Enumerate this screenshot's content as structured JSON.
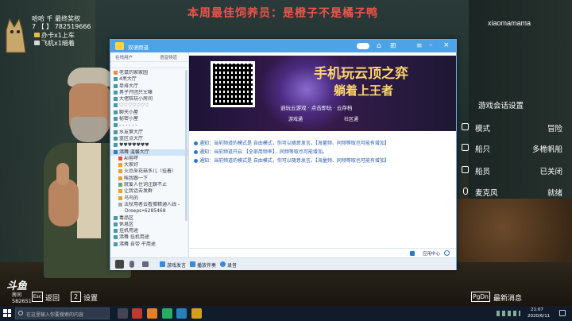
{
  "banner": "本周最佳饲养员：是橙子不是橘子鸭",
  "top_left": {
    "line1": "哈哈 千 最终奖权",
    "line2": "7 【  】 782519666",
    "line3": "办卡x1上车",
    "line4": "飞机x1暗着"
  },
  "watermark": "xiaomamama",
  "game_menu": {
    "title": "游戏会话设置",
    "rows": [
      {
        "label": "模式",
        "value": "冒险",
        "icon": "game-mode-icon"
      },
      {
        "label": "船只",
        "value": "多桅帆船",
        "icon": "ship-icon"
      },
      {
        "label": "船员",
        "value": "已关闭",
        "icon": "crew-icon"
      },
      {
        "label": "麦克风",
        "value": "就绪",
        "icon": "microphone-icon"
      }
    ]
  },
  "bottom_left": {
    "back_key": "Esc",
    "back_label": "返回",
    "settings_key": "2",
    "settings_label": "设置",
    "logo_main": "斗鱼",
    "logo_sub": "房间",
    "room_id": "582651"
  },
  "bottom_right": {
    "key": "PgDn",
    "label": "最新消息"
  },
  "yy": {
    "title": "双语频道",
    "panel_tabs": [
      "在线用户",
      "语音频道"
    ],
    "channels": [
      "老鼠的家家园",
      "4黑大厅",
      "单排大厅",
      "男子开团只军嘛",
      "大佬陪玩小房间",
      "♡♡♡♡♡♡♡",
      "聊天小屋",
      "秘密小屋",
      "- - - - - -",
      "水友第大厅",
      "蓝区点大厅",
      "♥♥♥♥♥♥♥",
      "沸舞 温馨大厅",
      "AI皂啰",
      "大家好",
      "火怂采花菇多儿（挂着）",
      "唉我跟一下",
      "就爱人住词注跳不止",
      "让我话去发群",
      "乌鸟的",
      "法杖用者云看蛋精通人线 -",
      "Dreeps•6285468",
      "毒品区",
      "休息区",
      "挂机用途",
      "沸舞 挂机用途",
      "沸舞 自带 干用途"
    ],
    "ad_title1": "手机玩云顶之弈",
    "ad_title2": "躺着上王者",
    "ad_sub": "逍玩云游戏 · 点击即玩 · 云存档",
    "ad_btn1": "游戏通",
    "ad_btn2": "社区通",
    "messages": [
      "通知：当前频道的模式是 自由模式，你可以随意发言。【海量频、同频等取也可能有增加】",
      "通知：当前频道开启 【全部用频率】，同频等取也可能增加。",
      "通知：当前频道的模式是 自由模式，你可以随意发言。【海量频、同频等取也可能有增加】"
    ],
    "bottom_items": [
      "游戏发言",
      "播放伴奏",
      "录音"
    ],
    "app_center": "应用中心"
  },
  "taskbar": {
    "search_placeholder": "在这里输入你要搜索的内容",
    "time": "21:07",
    "date": "2020/6/11"
  }
}
